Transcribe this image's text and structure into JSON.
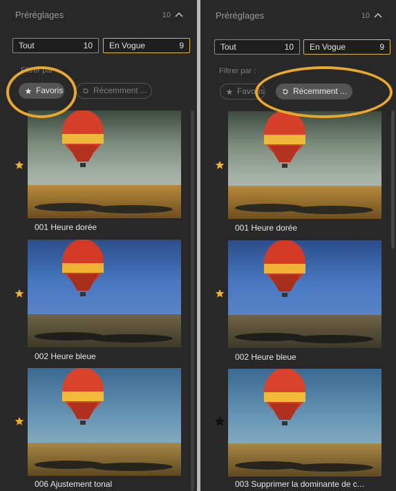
{
  "colors": {
    "panel_bg": "#282828",
    "accent": "#e3b93b",
    "annotation_ring": "#e9a82a",
    "star_filled": "#f0b02a",
    "star_dark": "#111111"
  },
  "panels": [
    {
      "header": {
        "title": "Préréglages",
        "count": "10",
        "chevron": "chevron-up-icon"
      },
      "tabs": [
        {
          "label": "Tout",
          "count": "10",
          "active": false
        },
        {
          "label": "En Vogue",
          "count": "9",
          "active": true
        }
      ],
      "filter": {
        "label": "Filtrer par :",
        "chips": [
          {
            "label": "Favoris",
            "icon": "star-icon",
            "selected": true
          },
          {
            "label": "Récemment ...",
            "icon": "history-icon",
            "selected": false
          }
        ]
      },
      "presets": [
        {
          "name": "001 Heure dorée",
          "favorite": "gold",
          "thumb_style": "golden"
        },
        {
          "name": "002 Heure bleue",
          "favorite": "gold",
          "thumb_style": "blue"
        },
        {
          "name": "006 Ajustement tonal",
          "favorite": "gold",
          "thumb_style": "tonal"
        }
      ]
    },
    {
      "header": {
        "title": "Préréglages",
        "count": "10",
        "chevron": "chevron-up-icon"
      },
      "tabs": [
        {
          "label": "Tout",
          "count": "10",
          "active": false
        },
        {
          "label": "En Vogue",
          "count": "9",
          "active": true
        }
      ],
      "filter": {
        "label": "Filtrer par :",
        "chips": [
          {
            "label": "Favoris",
            "icon": "star-icon",
            "selected": false
          },
          {
            "label": "Récemment ...",
            "icon": "history-icon",
            "selected": true
          }
        ]
      },
      "presets": [
        {
          "name": "001 Heure dorée",
          "favorite": "gold",
          "thumb_style": "golden"
        },
        {
          "name": "002 Heure bleue",
          "favorite": "gold",
          "thumb_style": "blue"
        },
        {
          "name": "003 Supprimer la dominante de c...",
          "favorite": "dark",
          "thumb_style": "tonal"
        }
      ]
    }
  ]
}
